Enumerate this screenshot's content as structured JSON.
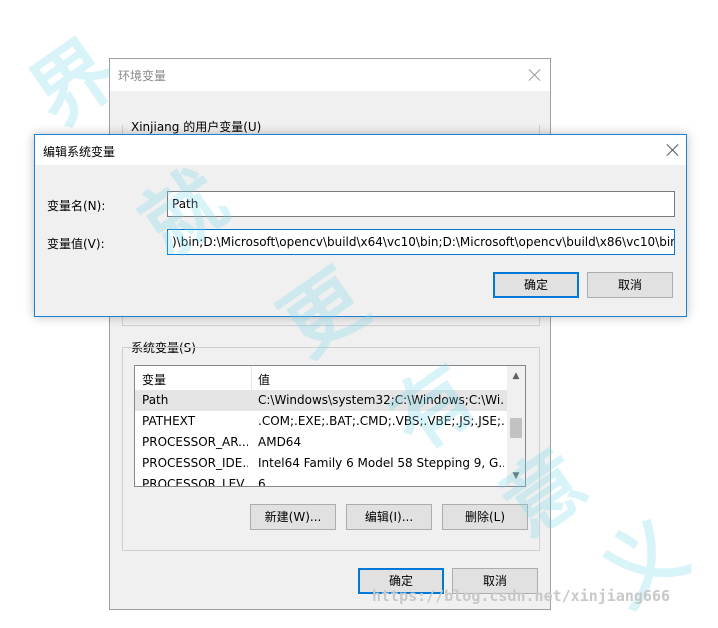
{
  "bg_window": {
    "title": "环境变量",
    "user_group_label": "Xinjiang 的用户变量(U)",
    "system_group_label": "系统变量(S)",
    "list": {
      "col_var": "变量",
      "col_val": "值",
      "rows": [
        {
          "name": "Path",
          "value": "C:\\Windows\\system32;C:\\Windows;C:\\Wi..."
        },
        {
          "name": "PATHEXT",
          "value": ".COM;.EXE;.BAT;.CMD;.VBS;.VBE;.JS;.JSE;..."
        },
        {
          "name": "PROCESSOR_AR...",
          "value": "AMD64"
        },
        {
          "name": "PROCESSOR_IDE...",
          "value": "Intel64 Family 6 Model 58 Stepping 9, G..."
        },
        {
          "name": "PROCESSOR_LEV...",
          "value": "6"
        }
      ]
    },
    "buttons": {
      "new": "新建(W)...",
      "edit": "编辑(I)...",
      "delete": "删除(L)",
      "ok": "确定",
      "cancel": "取消"
    }
  },
  "dialog": {
    "title": "编辑系统变量",
    "name_label": "变量名(N):",
    "name_value": "Path",
    "value_label": "变量值(V):",
    "value_value": ")\\bin;D:\\Microsoft\\opencv\\build\\x64\\vc10\\bin;D:\\Microsoft\\opencv\\build\\x86\\vc10\\bin",
    "ok": "确定",
    "cancel": "取消"
  },
  "watermark": {
    "glyphs": [
      "界",
      "就",
      "更",
      "有",
      "意",
      "义"
    ],
    "url": "https://blog.csdn.net/xinjiang666"
  },
  "colors": {
    "accent": "#0078d7",
    "dialog_border": "#1883d7",
    "watermark": "#78d7eb"
  }
}
